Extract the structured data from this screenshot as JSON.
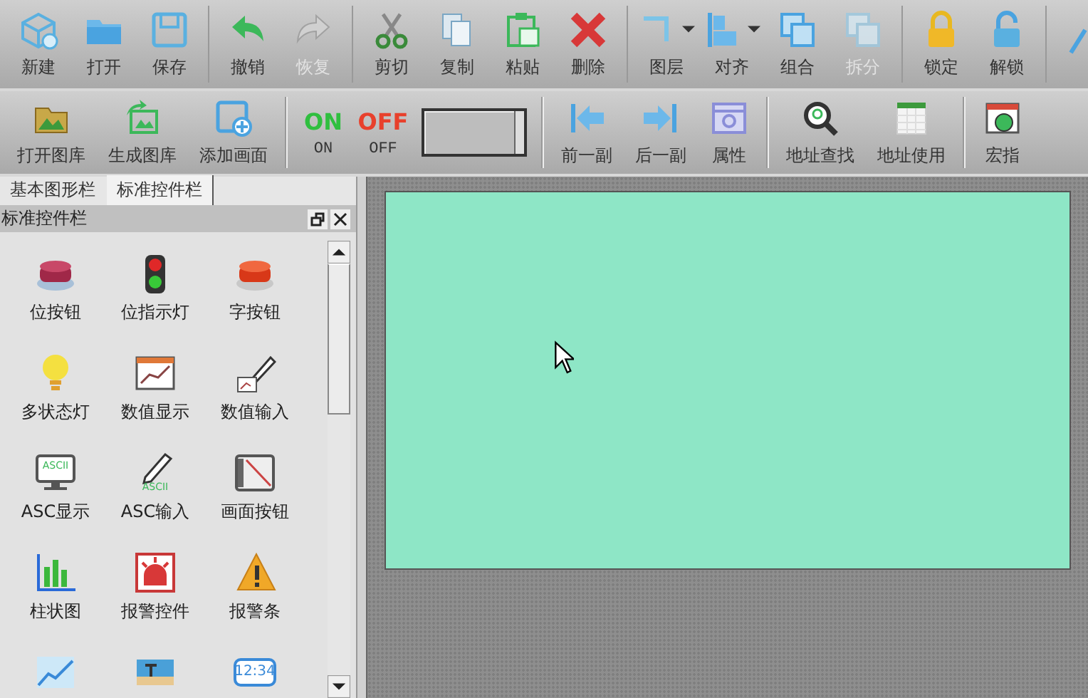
{
  "toolbar_top": {
    "groups": [
      [
        {
          "label": "新建",
          "disabled": false,
          "dropdown": false
        },
        {
          "label": "打开",
          "disabled": false,
          "dropdown": false
        },
        {
          "label": "保存",
          "disabled": false,
          "dropdown": false
        }
      ],
      [
        {
          "label": "撤销",
          "disabled": false,
          "dropdown": false
        },
        {
          "label": "恢复",
          "disabled": true,
          "dropdown": false
        }
      ],
      [
        {
          "label": "剪切",
          "disabled": false,
          "dropdown": false
        },
        {
          "label": "复制",
          "disabled": false,
          "dropdown": false
        },
        {
          "label": "粘贴",
          "disabled": false,
          "dropdown": false
        },
        {
          "label": "删除",
          "disabled": false,
          "dropdown": false
        }
      ],
      [
        {
          "label": "图层",
          "disabled": false,
          "dropdown": true
        },
        {
          "label": "对齐",
          "disabled": false,
          "dropdown": true
        },
        {
          "label": "组合",
          "disabled": false,
          "dropdown": false
        },
        {
          "label": "拆分",
          "disabled": true,
          "dropdown": false
        }
      ],
      [
        {
          "label": "锁定",
          "disabled": false,
          "dropdown": false
        },
        {
          "label": "解锁",
          "disabled": false,
          "dropdown": false
        }
      ],
      [
        {
          "disabled": false,
          "dropdown": false
        }
      ]
    ]
  },
  "toolbar_bottom": {
    "groups": [
      [
        {
          "kind": "button",
          "label": "打开图库"
        },
        {
          "kind": "button",
          "label": "生成图库"
        },
        {
          "kind": "button",
          "label": "添加画面"
        }
      ],
      [
        {
          "kind": "text-button",
          "label": "ON",
          "icon_text": "ON",
          "color": "#2fbf3f"
        },
        {
          "kind": "text-button",
          "label": "OFF",
          "icon_text": "OFF",
          "color": "#e8402c"
        },
        {
          "kind": "combo"
        }
      ],
      [
        {
          "kind": "button",
          "label": "前一副"
        },
        {
          "kind": "button",
          "label": "后一副"
        },
        {
          "kind": "button",
          "label": "属性"
        }
      ],
      [
        {
          "kind": "button",
          "label": "地址查找"
        },
        {
          "kind": "button",
          "label": "地址使用"
        }
      ],
      [
        {
          "kind": "button",
          "label": "宏指"
        }
      ]
    ]
  },
  "panel_tabs": [
    {
      "label": "基本图形栏",
      "selected": false
    },
    {
      "label": "标准控件栏",
      "selected": true
    }
  ],
  "panel": {
    "title": "标准控件栏",
    "items": [
      {
        "label": "位按钮"
      },
      {
        "label": "位指示灯"
      },
      {
        "label": "字按钮"
      },
      {
        "label": "多状态灯"
      },
      {
        "label": "数值显示"
      },
      {
        "label": "数值输入"
      },
      {
        "label": "ASC显示",
        "icon_text": "ASCII"
      },
      {
        "label": "ASC输入",
        "icon_text": "ASCII"
      },
      {
        "label": "画面按钮"
      },
      {
        "label": "柱状图"
      },
      {
        "label": "报警控件"
      },
      {
        "label": "报警条"
      }
    ],
    "clock_text": "12:34"
  }
}
